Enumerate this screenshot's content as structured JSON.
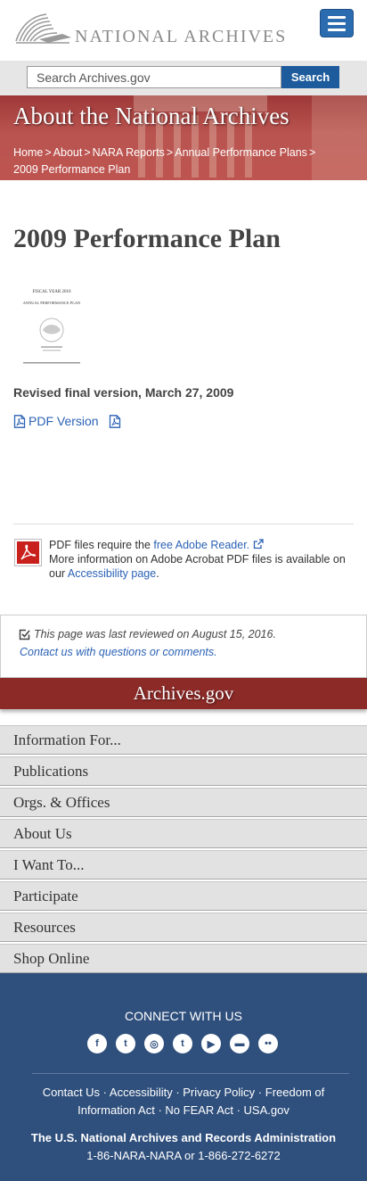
{
  "header": {
    "logo_text": "NATIONAL ARCHIVES"
  },
  "search": {
    "placeholder": "Search Archives.gov",
    "button_label": "Search"
  },
  "banner": {
    "title": "About the National Archives",
    "breadcrumb": [
      "Home",
      "About",
      "NARA Reports",
      "Annual Performance Plans",
      "2009 Performance Plan"
    ]
  },
  "main": {
    "page_title": "2009 Performance Plan",
    "doc_thumb": {
      "line1": "FISCAL YEAR 2010",
      "line2": "ANNUAL PERFORMANCE PLAN"
    },
    "revised": "Revised final version, March 27, 2009",
    "pdf_link": "PDF Version",
    "adobe": {
      "text1": "PDF files require the ",
      "link1": "free Adobe Reader.",
      "text2": "More information on Adobe Acrobat PDF files is available on our ",
      "link2": "Accessibility page",
      "text3": "."
    }
  },
  "review": {
    "line1": "This page was last reviewed on August 15, 2016.",
    "line2": "Contact us with questions or comments."
  },
  "archives_bar": {
    "title": "Archives.gov"
  },
  "footer_nav": [
    "Information For...",
    "Publications",
    "Orgs. & Offices",
    "About Us",
    "I Want To...",
    "Participate",
    "Resources",
    "Shop Online"
  ],
  "footer": {
    "connect": "CONNECT WITH US",
    "social": [
      {
        "icon": "facebook-icon",
        "glyph": "f"
      },
      {
        "icon": "twitter-icon",
        "glyph": "t"
      },
      {
        "icon": "instagram-icon",
        "glyph": "◎"
      },
      {
        "icon": "tumblr-icon",
        "glyph": "t"
      },
      {
        "icon": "youtube-icon",
        "glyph": "▶"
      },
      {
        "icon": "blog-icon",
        "glyph": "▬"
      },
      {
        "icon": "flickr-icon",
        "glyph": "••"
      }
    ],
    "links": [
      "Contact Us",
      "Accessibility",
      "Privacy Policy",
      "Freedom of Information Act",
      "No FEAR Act",
      "USA.gov"
    ],
    "org": "The U.S. National Archives and Records Administration",
    "phone": "1-86-NARA-NARA or 1-866-272-6272"
  },
  "colors": {
    "brand_blue": "#2f4f7c",
    "banner_red": "#8c2a27",
    "link_blue": "#2b62b5"
  }
}
